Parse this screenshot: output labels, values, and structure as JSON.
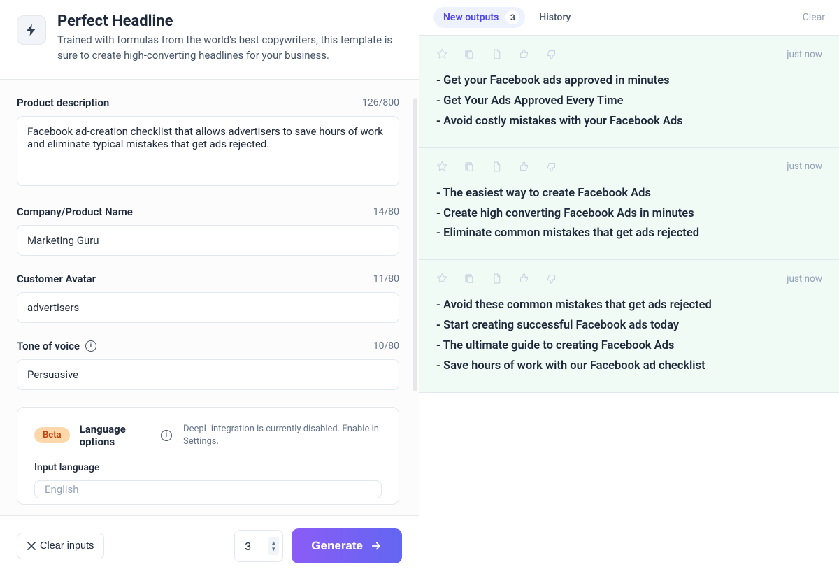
{
  "header": {
    "title": "Perfect Headline",
    "description": "Trained with formulas from the world's best copywriters, this template is sure to create high-converting headlines for your business."
  },
  "fields": {
    "product_description": {
      "label": "Product description",
      "count": "126/800",
      "value": "Facebook ad-creation checklist that allows advertisers to save hours of work and eliminate typical mistakes that get ads rejected."
    },
    "company_name": {
      "label": "Company/Product Name",
      "count": "14/80",
      "value": "Marketing Guru"
    },
    "customer_avatar": {
      "label": "Customer Avatar",
      "count": "11/80",
      "value": "advertisers"
    },
    "tone": {
      "label": "Tone of voice",
      "count": "10/80",
      "value": "Persuasive"
    }
  },
  "language": {
    "badge": "Beta",
    "title": "Language options",
    "note": "DeepL integration is currently disabled. Enable in Settings.",
    "input_label": "Input language",
    "input_value": "English"
  },
  "bottom": {
    "clear_label": "Clear inputs",
    "count_value": "3",
    "generate_label": "Generate"
  },
  "tabs": {
    "new_outputs_label": "New outputs",
    "new_outputs_count": "3",
    "history_label": "History",
    "clear_label": "Clear"
  },
  "outputs": [
    {
      "time": "just now",
      "lines": [
        "- Get your Facebook ads approved in minutes",
        "- Get Your Ads Approved Every Time",
        "- Avoid costly mistakes with your Facebook Ads"
      ]
    },
    {
      "time": "just now",
      "lines": [
        "- The easiest way to create Facebook Ads",
        "- Create high converting Facebook Ads in minutes",
        "- Eliminate common mistakes that get ads rejected"
      ]
    },
    {
      "time": "just now",
      "lines": [
        "- Avoid these common mistakes that get ads rejected",
        "- Start creating successful Facebook ads today",
        "- The ultimate guide to creating Facebook Ads",
        "- Save hours of work with our Facebook ad checklist"
      ]
    }
  ]
}
